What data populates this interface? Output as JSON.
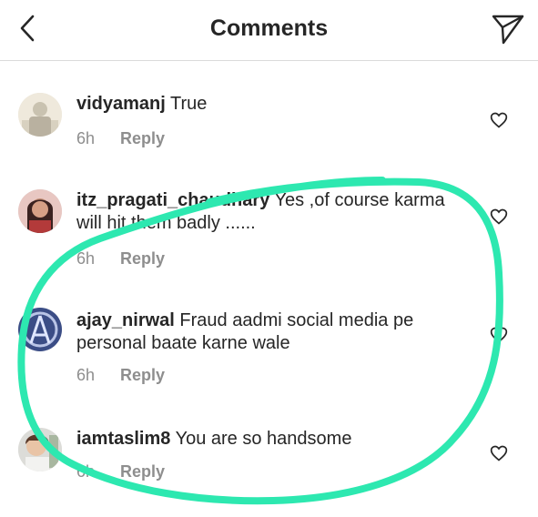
{
  "header": {
    "title": "Comments"
  },
  "comments": [
    {
      "username": "vidyamanj",
      "text": "True",
      "time": "6h",
      "reply": "Reply"
    },
    {
      "username": "itz_pragati_chaudhary",
      "text": "Yes ,of course karma will hit them badly ......",
      "time": "6h",
      "reply": "Reply"
    },
    {
      "username": "ajay_nirwal",
      "text": "Fraud aadmi social media pe personal baate karne wale",
      "time": "6h",
      "reply": "Reply"
    },
    {
      "username": "iamtaslim8",
      "text": "You are so handsome",
      "time": "6h",
      "reply": "Reply"
    }
  ],
  "colors": {
    "highlight": "#2de8b0",
    "secondary_text": "#8e8e8e",
    "divider": "#dbdbdb"
  }
}
